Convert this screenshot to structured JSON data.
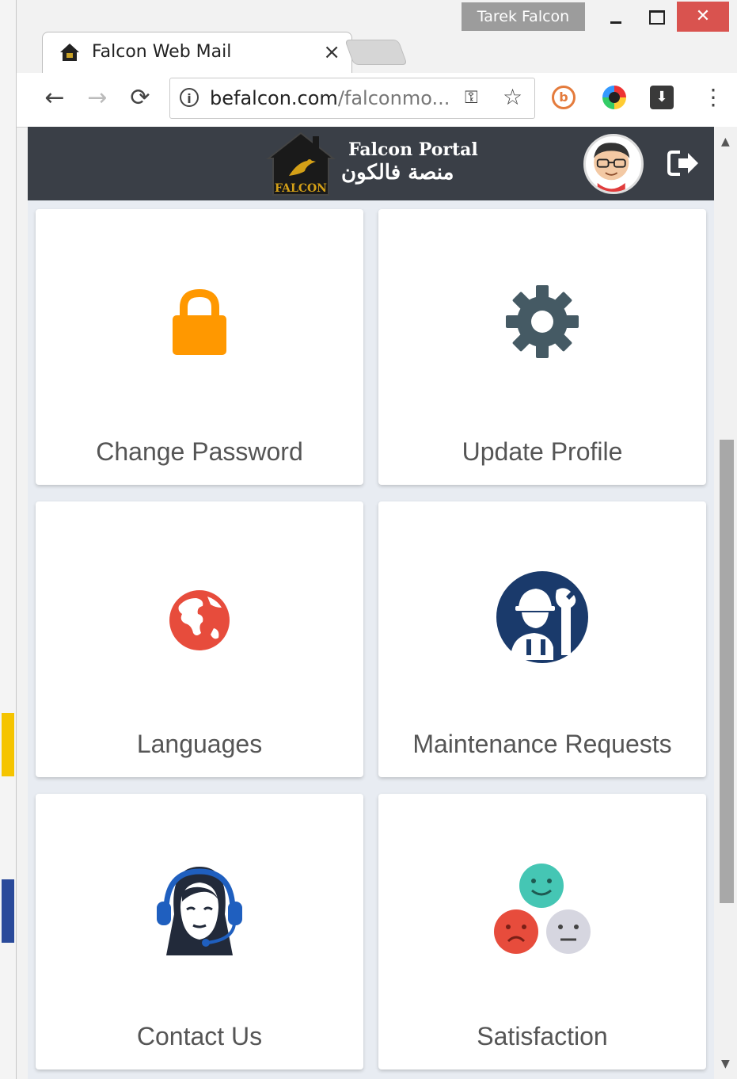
{
  "browser": {
    "profile_name": "Tarek Falcon",
    "tab_title": "Falcon Web Mail",
    "tab_close": "×",
    "url_host": "befalcon.com",
    "url_path": "/falconmo...",
    "window_close": "✕"
  },
  "portal": {
    "title_en": "Falcon Portal",
    "title_ar": "منصة فالكون",
    "logo_text": "FALCON"
  },
  "tiles": [
    {
      "label": "Change Password",
      "icon": "lock-icon",
      "color": "#ff9800"
    },
    {
      "label": "Update Profile",
      "icon": "gear-icon",
      "color": "#455a64"
    },
    {
      "label": "Languages",
      "icon": "globe-icon",
      "color": "#e74c3c"
    },
    {
      "label": "Maintenance Requests",
      "icon": "technician-icon",
      "color": "#1a3a6b"
    },
    {
      "label": "Contact Us",
      "icon": "support-agent-icon",
      "color": "#1f5fbf"
    },
    {
      "label": "Satisfaction",
      "icon": "satisfaction-faces-icon",
      "color": "#45c6b4"
    }
  ]
}
